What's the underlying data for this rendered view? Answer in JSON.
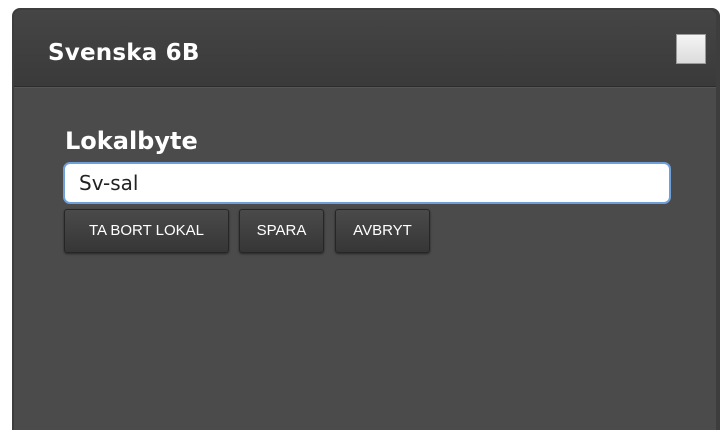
{
  "header": {
    "title": "Svenska 6B"
  },
  "form": {
    "section_label": "Lokalbyte",
    "room_value": "Sv-sal"
  },
  "actions": {
    "remove_label": "TA BORT LOKAL",
    "save_label": "SPARA",
    "cancel_label": "AVBRYT"
  },
  "colors": {
    "panel_background": "#4b4b4b",
    "header_background": "#3f3f3f",
    "input_focus_border": "#6f9fd8",
    "button_background": "#3d3d3d"
  }
}
